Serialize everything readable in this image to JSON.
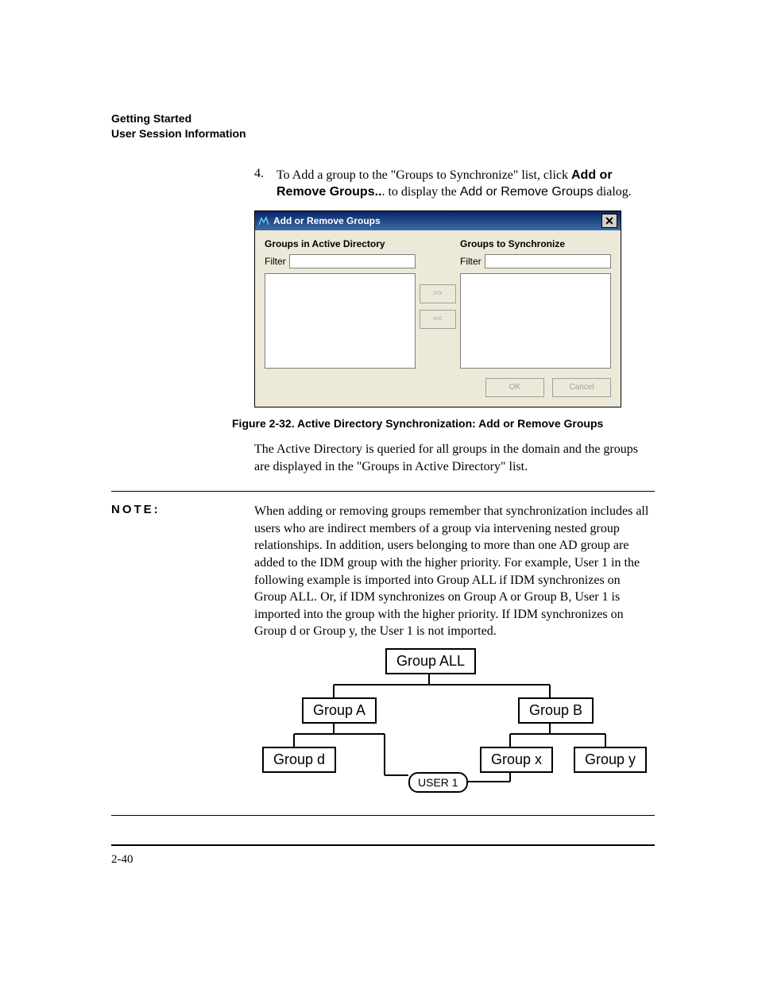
{
  "header": {
    "line1": "Getting Started",
    "line2": "User Session Information"
  },
  "step": {
    "number": "4.",
    "part1": "To Add a group to the \"Groups to Synchronize\" list, click ",
    "bold1": "Add or Remove Groups..",
    "part2": ". to display the ",
    "sans1": "Add or Remove Groups",
    "part3": " dialog."
  },
  "dialog": {
    "title": "Add or Remove Groups",
    "left_label": "Groups in Active Directory",
    "right_label": "Groups to Synchronize",
    "filter_label": "Filter",
    "btn_add": ">>",
    "btn_remove": "<<",
    "btn_ok": "OK",
    "btn_cancel": "Cancel"
  },
  "figure_caption": "Figure 2-32. Active Directory Synchronization: Add or Remove Groups",
  "para_after_figure": "The Active Directory is queried for all groups in the domain and the groups are displayed in the \"Groups in Active Directory\" list.",
  "note": {
    "label": "NOTE:",
    "body": "When adding or removing groups remember that synchronization includes all users who are indirect members of a group via intervening nested group relationships. In addition, users belonging to more than one AD group are added to the IDM group with the higher priority. For example, User 1 in the following example is imported into Group ALL if IDM synchronizes on Group ALL. Or, if IDM synchronizes on Group A or Group B, User 1 is imported into the group with the higher priority. If IDM synchronizes on Group d or Group y, the User 1 is not imported."
  },
  "diagram": {
    "group_all": "Group ALL",
    "group_a": "Group A",
    "group_b": "Group B",
    "group_d": "Group d",
    "group_x": "Group x",
    "group_y": "Group y",
    "user1": "USER 1"
  },
  "page_number": "2-40"
}
